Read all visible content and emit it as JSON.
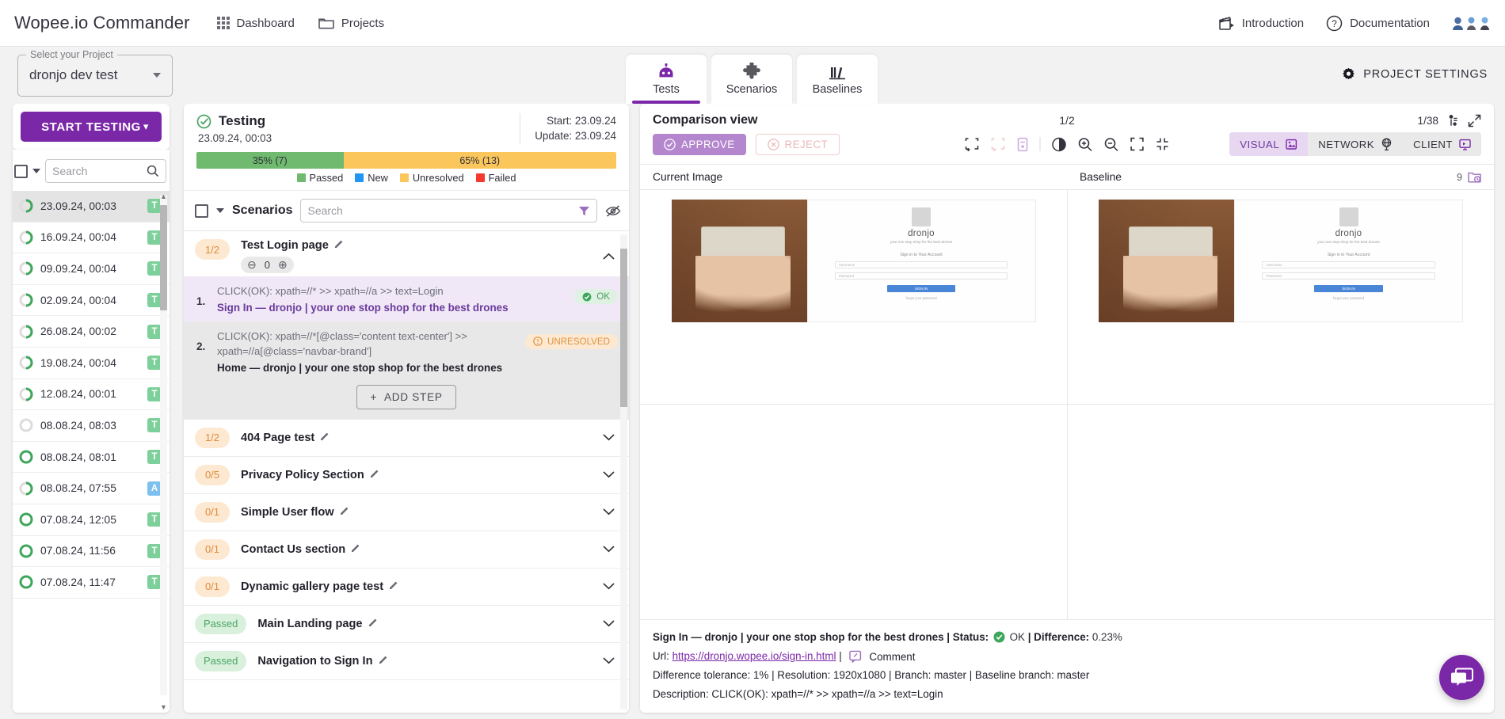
{
  "topbar": {
    "brand": "Wopee.io Commander",
    "nav": [
      {
        "label": "Dashboard",
        "icon": "grid-icon"
      },
      {
        "label": "Projects",
        "icon": "folder-icon"
      }
    ],
    "right": [
      {
        "label": "Introduction",
        "icon": "clapperboard-icon"
      },
      {
        "label": "Documentation",
        "icon": "question-circle-icon"
      }
    ]
  },
  "secondbar": {
    "project_legend": "Select your Project",
    "project_value": "dronjo dev test",
    "tabs": [
      {
        "label": "Tests",
        "icon": "robot-icon",
        "active": true
      },
      {
        "label": "Scenarios",
        "icon": "puzzle-icon",
        "active": false
      },
      {
        "label": "Baselines",
        "icon": "books-icon",
        "active": false
      }
    ],
    "project_settings": "PROJECT SETTINGS"
  },
  "sidebar": {
    "start_testing": "START TESTING",
    "search_placeholder": "Search",
    "search_value": "",
    "runs": [
      {
        "label": "23.09.24, 00:03",
        "badge": "T",
        "badge_type": "t",
        "progress": "partial",
        "selected": true
      },
      {
        "label": "16.09.24, 00:04",
        "badge": "T",
        "badge_type": "t",
        "progress": "partial",
        "selected": false
      },
      {
        "label": "09.09.24, 00:04",
        "badge": "T",
        "badge_type": "t",
        "progress": "partial",
        "selected": false
      },
      {
        "label": "02.09.24, 00:04",
        "badge": "T",
        "badge_type": "t",
        "progress": "partial",
        "selected": false
      },
      {
        "label": "26.08.24, 00:02",
        "badge": "T",
        "badge_type": "t",
        "progress": "partial",
        "selected": false
      },
      {
        "label": "19.08.24, 00:04",
        "badge": "T",
        "badge_type": "t",
        "progress": "partial",
        "selected": false
      },
      {
        "label": "12.08.24, 00:01",
        "badge": "T",
        "badge_type": "t",
        "progress": "partial",
        "selected": false
      },
      {
        "label": "08.08.24, 08:03",
        "badge": "T",
        "badge_type": "t",
        "progress": "empty",
        "selected": false
      },
      {
        "label": "08.08.24, 08:01",
        "badge": "T",
        "badge_type": "t",
        "progress": "full",
        "selected": false
      },
      {
        "label": "08.08.24, 07:55",
        "badge": "A",
        "badge_type": "a",
        "progress": "partial",
        "selected": false
      },
      {
        "label": "07.08.24, 12:05",
        "badge": "T",
        "badge_type": "t",
        "progress": "full",
        "selected": false
      },
      {
        "label": "07.08.24, 11:56",
        "badge": "T",
        "badge_type": "t",
        "progress": "full",
        "selected": false
      },
      {
        "label": "07.08.24, 11:47",
        "badge": "T",
        "badge_type": "t",
        "progress": "full",
        "selected": false
      }
    ]
  },
  "testing": {
    "title": "Testing",
    "subtitle": "23.09.24, 00:03",
    "start": "Start: 23.09.24",
    "update": "Update: 23.09.24",
    "progress": {
      "passed": {
        "label": "35% (7)",
        "pct": 35,
        "color": "#6fba6f"
      },
      "unresolved": {
        "label": "65% (13)",
        "pct": 65,
        "color": "#fbc75d"
      }
    },
    "legend": [
      {
        "label": "Passed",
        "color": "#6fba6f"
      },
      {
        "label": "New",
        "color": "#2196f3"
      },
      {
        "label": "Unresolved",
        "color": "#fbc75d"
      },
      {
        "label": "Failed",
        "color": "#f4392e"
      }
    ]
  },
  "scenarios": {
    "title": "Scenarios",
    "search_placeholder": "Search",
    "search_value": "",
    "expanded": {
      "badge": "1/2",
      "badge_type": "partial",
      "name": "Test Login page",
      "counter_value": "0",
      "add_step": "ADD STEP",
      "steps": [
        {
          "num": "1.",
          "command": "CLICK(OK): xpath=//* >> xpath=//a >> text=Login",
          "title": "Sign In — dronjo | your one stop shop for the best drones",
          "status": "OK",
          "status_type": "ok"
        },
        {
          "num": "2.",
          "command": "CLICK(OK): xpath=//*[@class='content text-center'] >> xpath=//a[@class='navbar-brand']",
          "title": "Home — dronjo | your one stop shop for the best drones",
          "status": "UNRESOLVED",
          "status_type": "unres"
        }
      ]
    },
    "items": [
      {
        "badge": "1/2",
        "badge_type": "partial",
        "name": "404 Page test"
      },
      {
        "badge": "0/5",
        "badge_type": "partial",
        "name": "Privacy Policy Section"
      },
      {
        "badge": "0/1",
        "badge_type": "partial",
        "name": "Simple User flow"
      },
      {
        "badge": "0/1",
        "badge_type": "partial",
        "name": "Contact Us section"
      },
      {
        "badge": "0/1",
        "badge_type": "partial",
        "name": "Dynamic gallery page test"
      },
      {
        "badge": "Passed",
        "badge_type": "passed",
        "name": "Main Landing page"
      },
      {
        "badge": "Passed",
        "badge_type": "passed",
        "name": "Navigation to Sign In"
      }
    ]
  },
  "comparison": {
    "title": "Comparison view",
    "counter": "1/2",
    "image_counter": "1/38",
    "approve": "APPROVE",
    "reject": "REJECT",
    "views": [
      {
        "label": "VISUAL",
        "icon": "image-view-icon",
        "active": true
      },
      {
        "label": "NETWORK",
        "icon": "globe-icon",
        "active": false
      },
      {
        "label": "CLIENT",
        "icon": "monitor-icon",
        "active": false
      }
    ],
    "tools": [
      {
        "name": "add-region-icon"
      },
      {
        "name": "remove-region-icon"
      },
      {
        "name": "ignore-area-icon"
      },
      {
        "name": "contrast-icon"
      },
      {
        "name": "zoom-in-icon"
      },
      {
        "name": "zoom-out-icon"
      },
      {
        "name": "fit-screen-icon"
      },
      {
        "name": "collapse-icon"
      }
    ],
    "col_current": "Current Image",
    "col_baseline": "Baseline",
    "baseline_history_count": "9",
    "shot": {
      "brand": "dronjo",
      "tagline": "your one stop shop for the best drones",
      "signin_heading": "Sign in to Your Account",
      "username_placeholder": "Username",
      "password_placeholder": "Password",
      "submit": "SIGN IN",
      "forgot": "forgot your password"
    },
    "footer": {
      "headline_title": "Sign In — dronjo | your one stop shop for the best drones",
      "status_label": "Status:",
      "status_value": "OK",
      "difference_label": "Difference:",
      "difference_value": "0.23%",
      "url_label": "Url:",
      "url_value": "https://dronjo.wopee.io/sign-in.html",
      "comment": "Comment",
      "meta": "Difference tolerance: 1% | Resolution: 1920x1080 | Branch: master | Baseline branch: master",
      "description": "Description: CLICK(OK): xpath=//* >> xpath=//a >> text=Login"
    }
  },
  "colors": {
    "accent": "#7b28a8",
    "accent_light": "#b386cd",
    "green": "#6fba6f",
    "amber": "#fbc75d",
    "red": "#f4392e",
    "blue": "#2196f3"
  }
}
